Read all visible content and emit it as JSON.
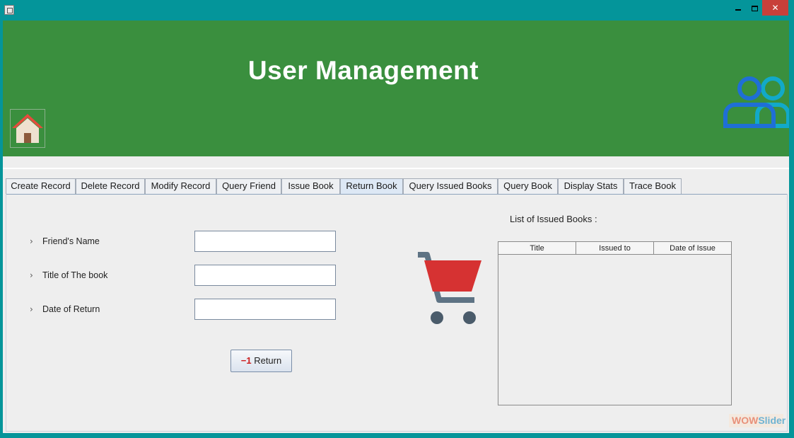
{
  "window": {
    "minimize_glyph": "",
    "maximize_glyph": "",
    "close_glyph": "✕"
  },
  "header": {
    "title": "User Management",
    "icons": [
      "home-icon",
      "users-icon"
    ],
    "colors": {
      "background": "#3a8f3e",
      "title": "#ffffff"
    }
  },
  "tabs": [
    {
      "label": "Create Record",
      "active": false
    },
    {
      "label": "Delete Record",
      "active": false
    },
    {
      "label": "Modify Record",
      "active": false
    },
    {
      "label": "Query Friend",
      "active": false
    },
    {
      "label": "Issue Book",
      "active": false
    },
    {
      "label": "Return Book",
      "active": true
    },
    {
      "label": "Query Issued Books",
      "active": false
    },
    {
      "label": "Query Book",
      "active": false
    },
    {
      "label": "Display Stats",
      "active": false
    },
    {
      "label": "Trace Book",
      "active": false
    }
  ],
  "form": {
    "fields": [
      {
        "label": "Friend's Name",
        "value": ""
      },
      {
        "label": "Title of The book",
        "value": ""
      },
      {
        "label": "Date of Return",
        "value": ""
      }
    ],
    "return_button": {
      "icon_text": "−1",
      "label": "Return"
    }
  },
  "issued_list": {
    "label": "List of Issued Books :",
    "columns": [
      "Title",
      "Issued to",
      "Date of Issue"
    ],
    "rows": []
  },
  "watermark": {
    "part1": "WOW",
    "part2": "Slider"
  }
}
